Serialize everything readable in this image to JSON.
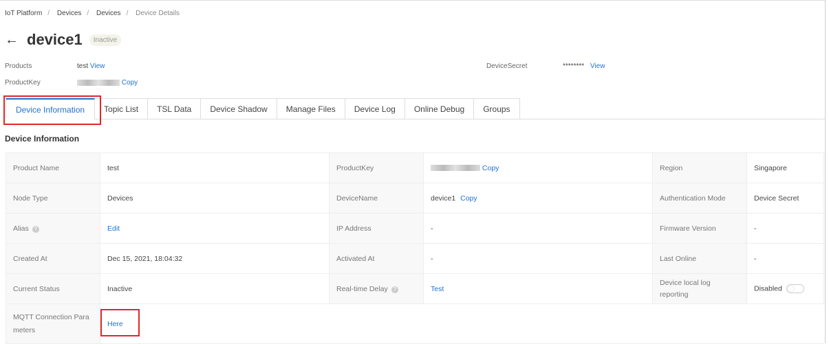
{
  "breadcrumb": [
    "IoT Platform",
    "Devices",
    "Devices",
    "Device Details"
  ],
  "header": {
    "title": "device1",
    "status": "Inactive"
  },
  "meta": {
    "products_label": "Products",
    "products_value": "test",
    "products_link": "View",
    "productkey_label": "ProductKey",
    "productkey_link": "Copy",
    "secret_label": "DeviceSecret",
    "secret_value": "********",
    "secret_link": "View"
  },
  "tabs": [
    "Device Information",
    "Topic List",
    "TSL Data",
    "Device Shadow",
    "Manage Files",
    "Device Log",
    "Online Debug",
    "Groups"
  ],
  "section_title": "Device Information",
  "rows": [
    {
      "l1": "Product Name",
      "v1": "test",
      "l2": "ProductKey",
      "v2_link": "Copy",
      "l3": "Region",
      "v3": "Singapore"
    },
    {
      "l1": "Node Type",
      "v1": "Devices",
      "l2": "DeviceName",
      "v2": "device1",
      "v2_link": "Copy",
      "l3": "Authentication Mode",
      "v3": "Device Secret"
    },
    {
      "l1": "Alias",
      "v1_link": "Edit",
      "l2": "IP Address",
      "v2": "-",
      "l3": "Firmware Version",
      "v3": "-"
    },
    {
      "l1": "Created At",
      "v1": "Dec 15, 2021, 18:04:32",
      "l2": "Activated At",
      "v2": "-",
      "l3": "Last Online",
      "v3": "-"
    },
    {
      "l1": "Current Status",
      "v1": "Inactive",
      "l2": "Real-time Delay",
      "v2_link": "Test",
      "l3": "Device local log reporting",
      "v3": "Disabled"
    },
    {
      "l1": "MQTT Connection Parameters",
      "v1_link": "Here"
    }
  ]
}
